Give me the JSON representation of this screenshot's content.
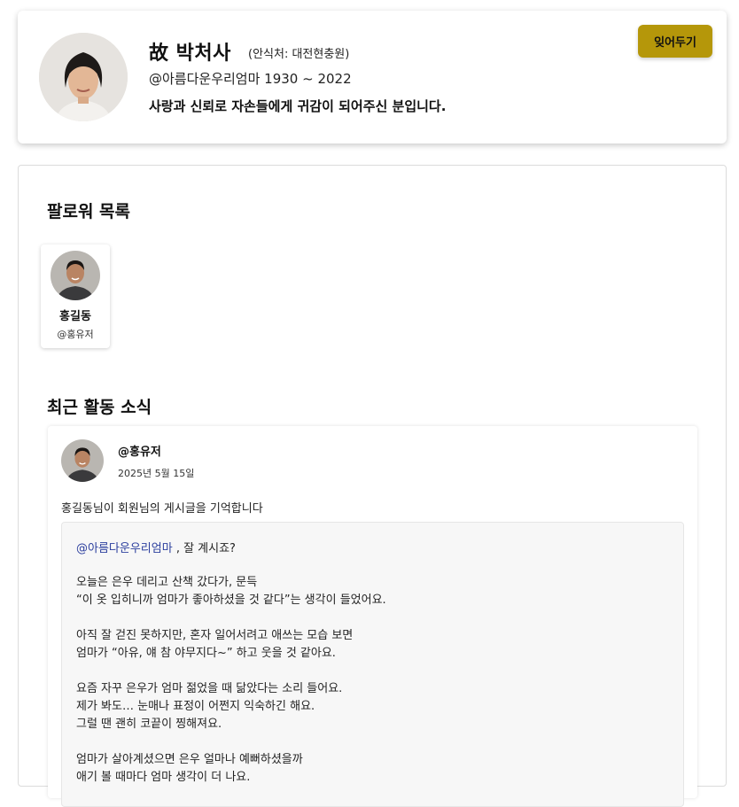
{
  "profile": {
    "name": "故 박처사",
    "place": "(안식처: 대전현충원)",
    "handle_years": "@아름다운우리엄마 1930 ~ 2022",
    "description": "사랑과 신뢰로 자손들에게 귀감이 되어주신 분입니다.",
    "forget_button": "잊어두기",
    "accent_color": "#b5970a"
  },
  "followers": {
    "title": "팔로워 목록",
    "items": [
      {
        "name": "홍길동",
        "handle": "@홍유저"
      }
    ]
  },
  "activity": {
    "title": "최근 활동 소식",
    "post": {
      "author": "@홍유저",
      "date": "2025년 5월 15일",
      "summary": "홍길동님이 회원님의 게시글을 기억합니다",
      "mention": "@아름다운우리엄마",
      "greeting": " , 잘 계시죠?",
      "lines": [
        "오늘은 은우 데리고 산책 갔다가, 문득",
        "“이 옷 입히니까 엄마가 좋아하셨을 것 같다”는 생각이 들었어요.",
        "",
        "아직 잘 걷진 못하지만, 혼자 일어서려고 애쓰는 모습 보면",
        "엄마가 “아유, 얘 참 야무지다~” 하고 웃을 것 같아요.",
        "",
        "요즘 자꾸 은우가 엄마 젊었을 때 닮았다는 소리 들어요.",
        "제가 봐도… 눈매나 표정이 어쩐지 익숙하긴 해요.",
        "그럴 땐 괜히 코끝이 찡해져요.",
        "",
        "엄마가 살아계셨으면 은우 얼마나 예뻐하셨을까",
        "애기 볼 때마다 엄마 생각이 더 나요."
      ]
    }
  }
}
